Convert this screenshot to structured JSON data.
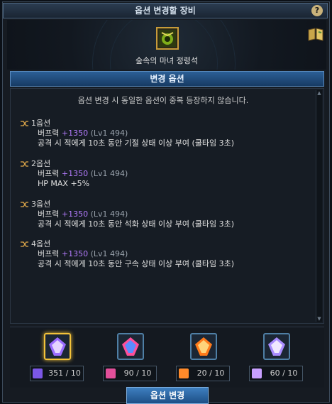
{
  "window": {
    "title": "옵션 변경할 장비"
  },
  "item": {
    "name": "숲속의 마녀 정령석"
  },
  "section": {
    "title": "변경 옵션"
  },
  "notice": "옵션 변경 시 동일한 옵션이 중복 등장하지 않습니다.",
  "options": [
    {
      "label": "1옵션",
      "stat": "버프력",
      "value": "+1350",
      "level": "(Lv1 494)",
      "effect": "공격 시 적에게 10초 동안 기절 상태 이상 부여 (쿨타임 3초)"
    },
    {
      "label": "2옵션",
      "stat": "버프력",
      "value": "+1350",
      "level": "(Lv1 494)",
      "effect": "HP MAX +5%"
    },
    {
      "label": "3옵션",
      "stat": "버프력",
      "value": "+1350",
      "level": "(Lv1 494)",
      "effect": "공격 시 적에게 10초 동안 석화 상태 이상 부여 (쿨타임 3초)"
    },
    {
      "label": "4옵션",
      "stat": "버프력",
      "value": "+1350",
      "level": "(Lv1 494)",
      "effect": "공격 시 적에게 10초 동안 구속 상태 이상 부여 (쿨타임 3초)"
    }
  ],
  "stones": [
    {
      "count": "351 / 10",
      "selected": true,
      "color": "#b98cff"
    },
    {
      "count": "90 / 10",
      "selected": false,
      "color": "#ff5fa8"
    },
    {
      "count": "20 / 10",
      "selected": false,
      "color": "#ff8a2a"
    },
    {
      "count": "60 / 10",
      "selected": false,
      "color": "#c8a0ff"
    }
  ],
  "buttons": {
    "change": "옵션 변경",
    "help": "?"
  },
  "colors": {
    "accent": "#2c5f96",
    "option_value": "#b57cff",
    "selected_border": "#f3c23a"
  }
}
